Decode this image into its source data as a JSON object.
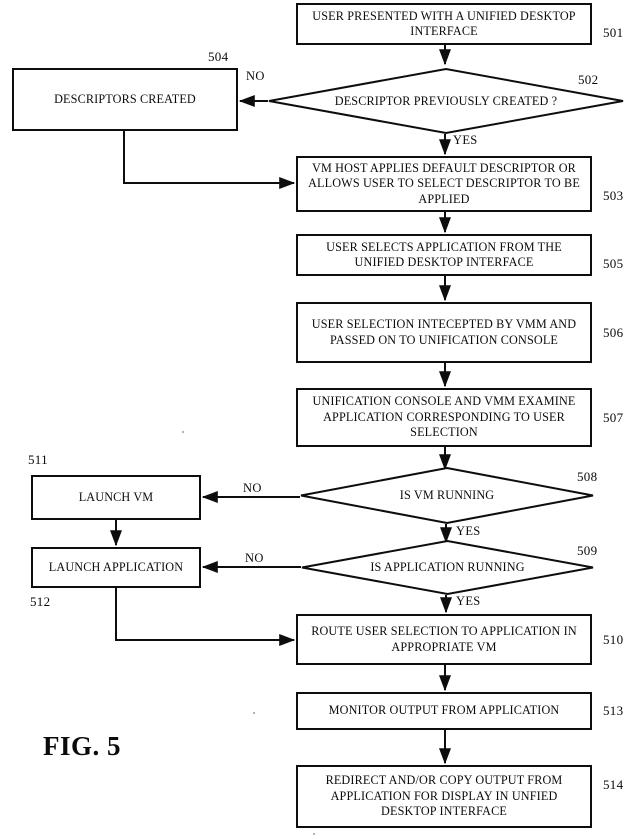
{
  "figure": {
    "caption": "FIG. 5",
    "type": "flowchart"
  },
  "nodes": [
    {
      "id": "501",
      "shape": "process",
      "ref": "501",
      "text": "USER PRESENTED WITH A UNIFIED DESKTOP INTERFACE"
    },
    {
      "id": "502",
      "shape": "decision",
      "ref": "502",
      "text": "DESCRIPTOR PREVIOUSLY CREATED ?"
    },
    {
      "id": "504",
      "shape": "process",
      "ref": "504",
      "text": "DESCRIPTORS CREATED"
    },
    {
      "id": "503",
      "shape": "process",
      "ref": "503",
      "text": "VM HOST APPLIES DEFAULT DESCRIPTOR OR ALLOWS USER TO SELECT DESCRIPTOR TO BE APPLIED"
    },
    {
      "id": "505",
      "shape": "process",
      "ref": "505",
      "text": "USER SELECTS APPLICATION FROM THE UNIFIED DESKTOP INTERFACE"
    },
    {
      "id": "506",
      "shape": "process",
      "ref": "506",
      "text": "USER SELECTION INTECEPTED BY VMM AND PASSED ON TO UNIFICATION CONSOLE"
    },
    {
      "id": "507",
      "shape": "process",
      "ref": "507",
      "text": "UNIFICATION CONSOLE AND VMM EXAMINE APPLICATION CORRESPONDING TO USER SELECTION"
    },
    {
      "id": "508",
      "shape": "decision",
      "ref": "508",
      "text": "IS VM RUNNING"
    },
    {
      "id": "511",
      "shape": "process",
      "ref": "511",
      "text": "LAUNCH VM"
    },
    {
      "id": "509",
      "shape": "decision",
      "ref": "509",
      "text": "IS APPLICATION RUNNING"
    },
    {
      "id": "512",
      "shape": "process",
      "ref": "512",
      "text": "LAUNCH APPLICATION"
    },
    {
      "id": "510",
      "shape": "process",
      "ref": "510",
      "text": "ROUTE USER SELECTION TO APPLICATION IN APPROPRIATE VM"
    },
    {
      "id": "513",
      "shape": "process",
      "ref": "513",
      "text": "MONITOR OUTPUT FROM APPLICATION"
    },
    {
      "id": "514",
      "shape": "process",
      "ref": "514",
      "text": "REDIRECT AND/OR COPY OUTPUT FROM APPLICATION FOR DISPLAY IN UNFIED DESKTOP INTERFACE"
    }
  ],
  "branch_labels": {
    "d502_no": "NO",
    "d502_yes": "YES",
    "d508_no": "NO",
    "d508_yes": "YES",
    "d509_no": "NO",
    "d509_yes": "YES"
  },
  "colors": {
    "ink": "#0b0b0b",
    "paper": "#ffffff"
  }
}
